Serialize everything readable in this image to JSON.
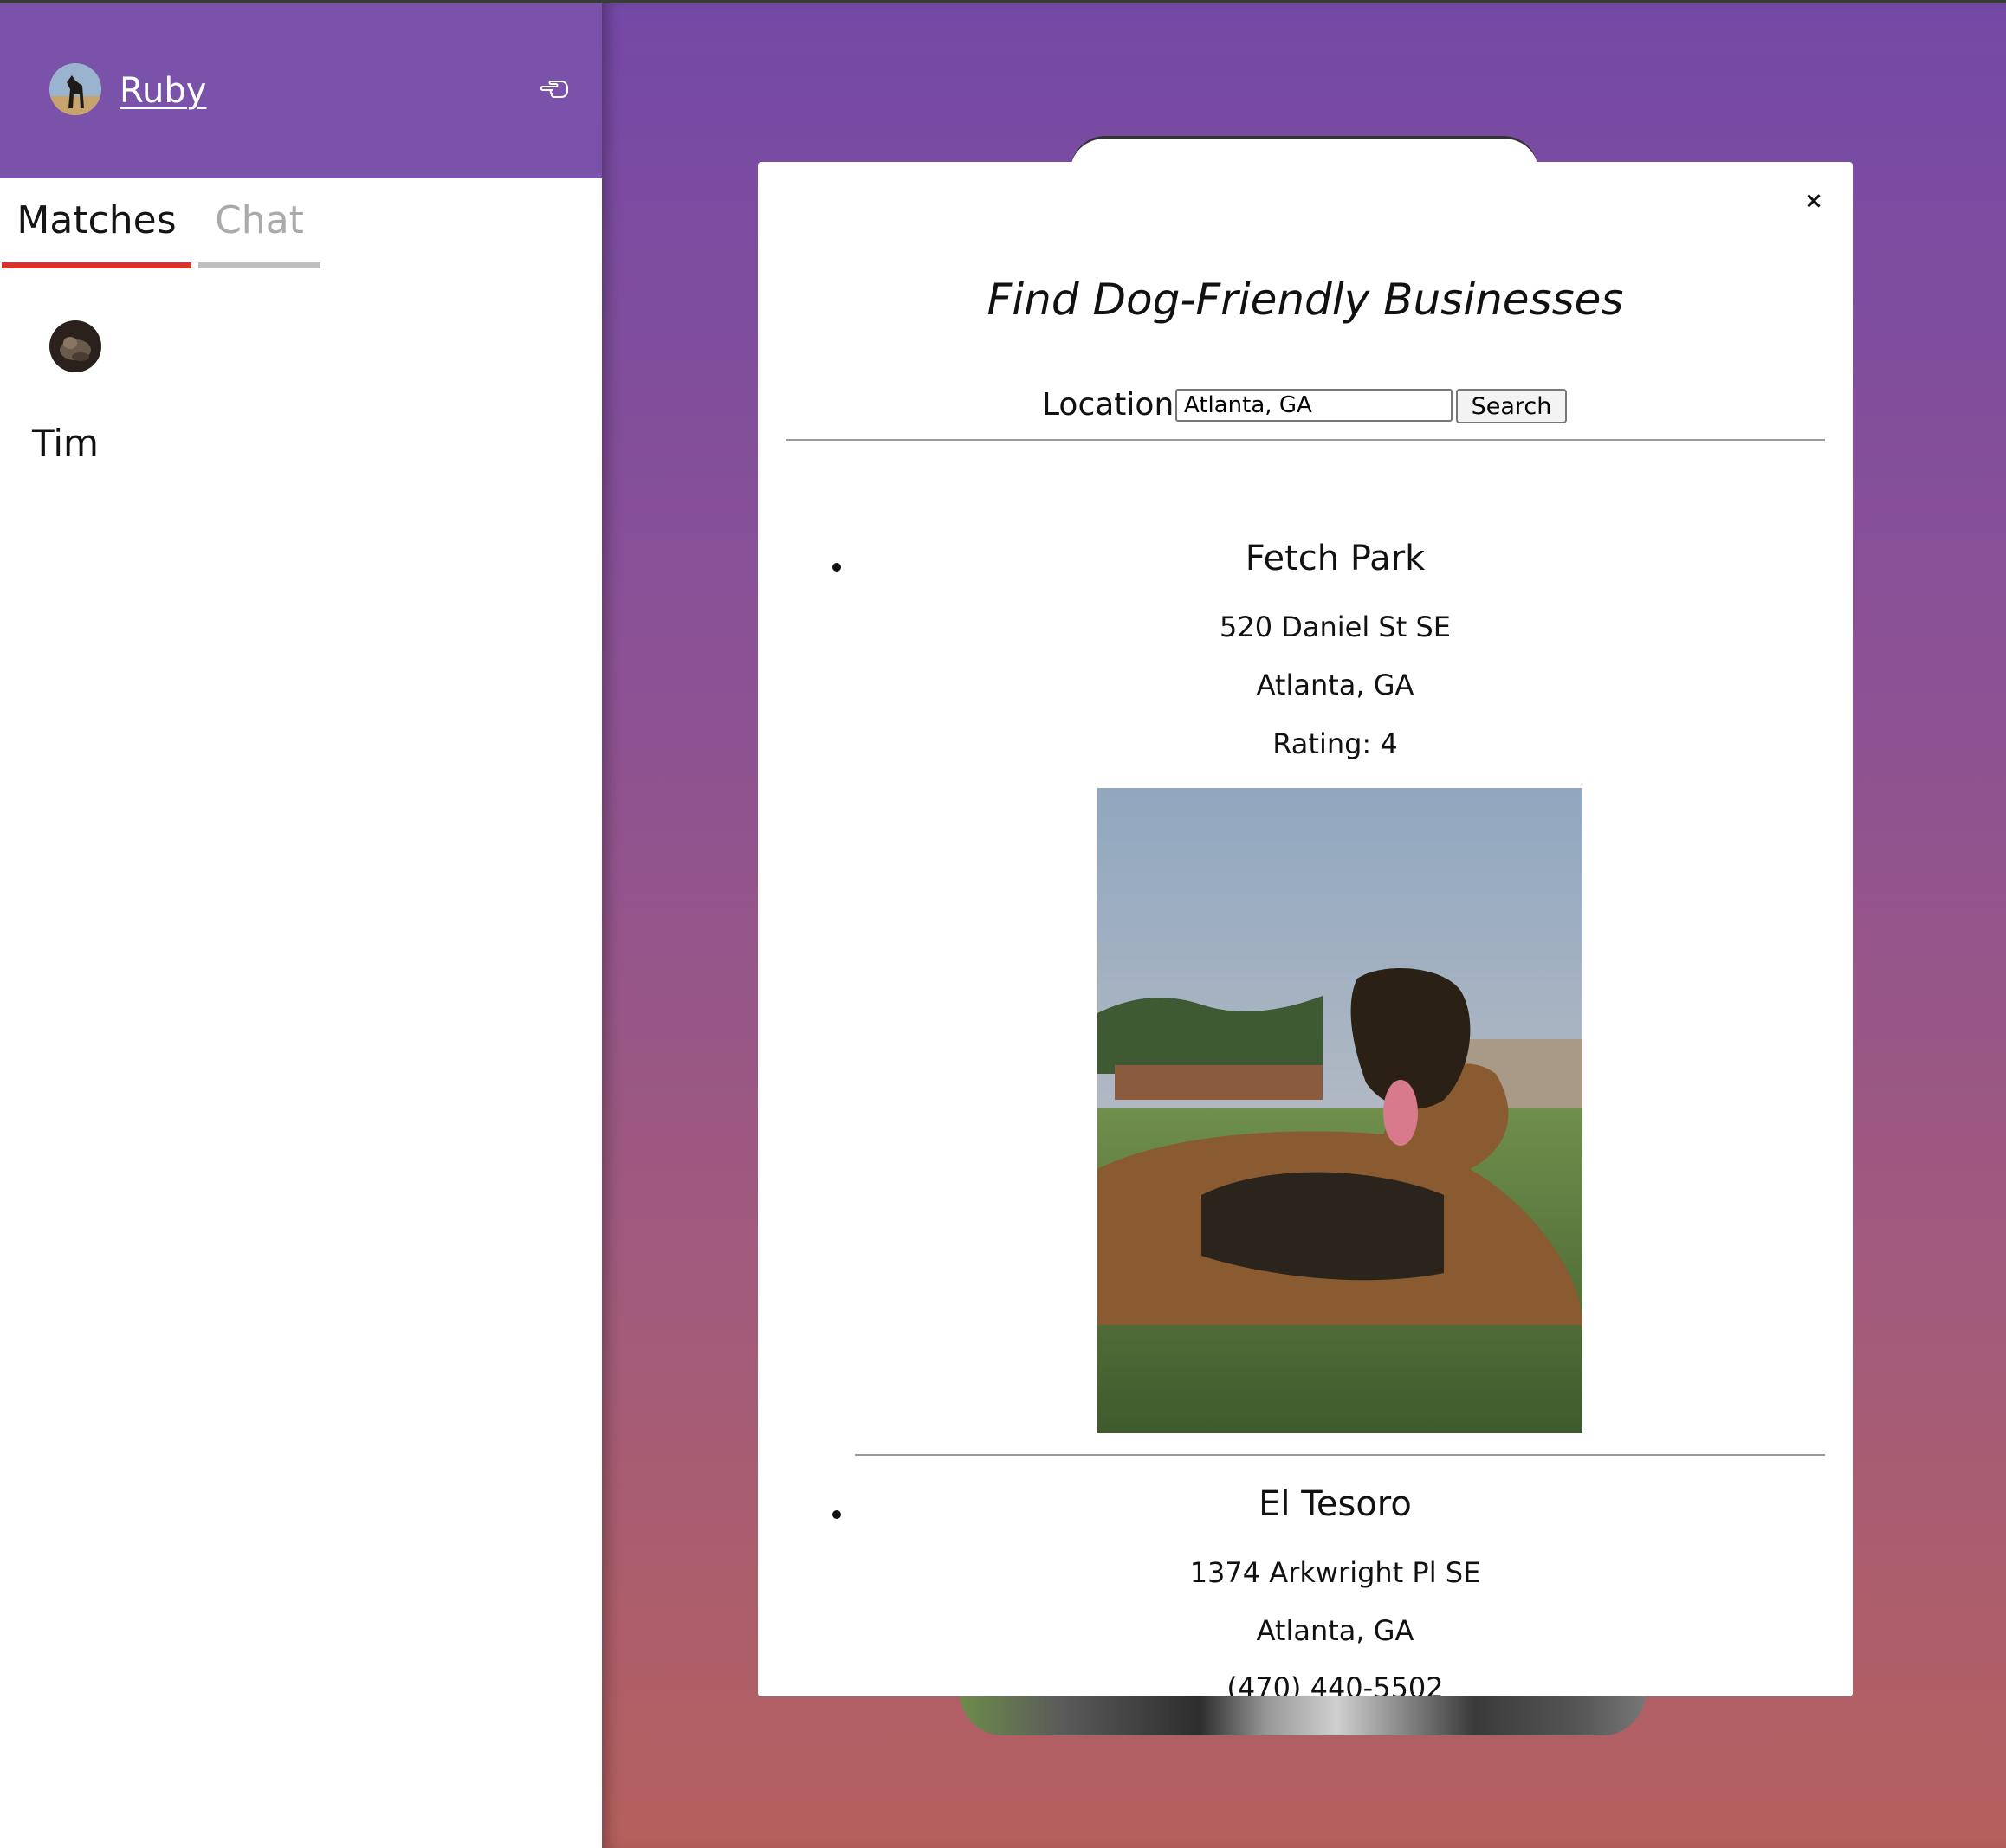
{
  "sidebar": {
    "user": {
      "name": "Ruby",
      "avatar_icon": "dog-avatar"
    },
    "header_icon": "pointing-hand-icon",
    "tabs": [
      {
        "label": "Matches",
        "active": true
      },
      {
        "label": "Chat",
        "active": false
      }
    ],
    "matches": [
      {
        "name": "Tim",
        "avatar_icon": "dog-avatar"
      }
    ]
  },
  "modal": {
    "title": "Find Dog-Friendly Businesses",
    "close_label": "×",
    "location_label": "Location:",
    "location_value": "Atlanta, GA",
    "search_label": "Search",
    "results": [
      {
        "name": "Fetch Park",
        "address": "520 Daniel St SE",
        "city": "Atlanta, GA",
        "rating": "Rating: 4",
        "photo": "photo of German Shepherd lying on turf"
      },
      {
        "name": "El Tesoro",
        "address": "1374 Arkwright Pl SE",
        "city": "Atlanta, GA",
        "phone": "(470) 440-5502"
      }
    ]
  },
  "colors": {
    "header_purple": "#7b52aa",
    "active_tab_accent": "#d9322b",
    "inactive_tab": "#bdbdbd",
    "gradient_top": "#7449a6",
    "gradient_bottom": "#b5605d"
  }
}
